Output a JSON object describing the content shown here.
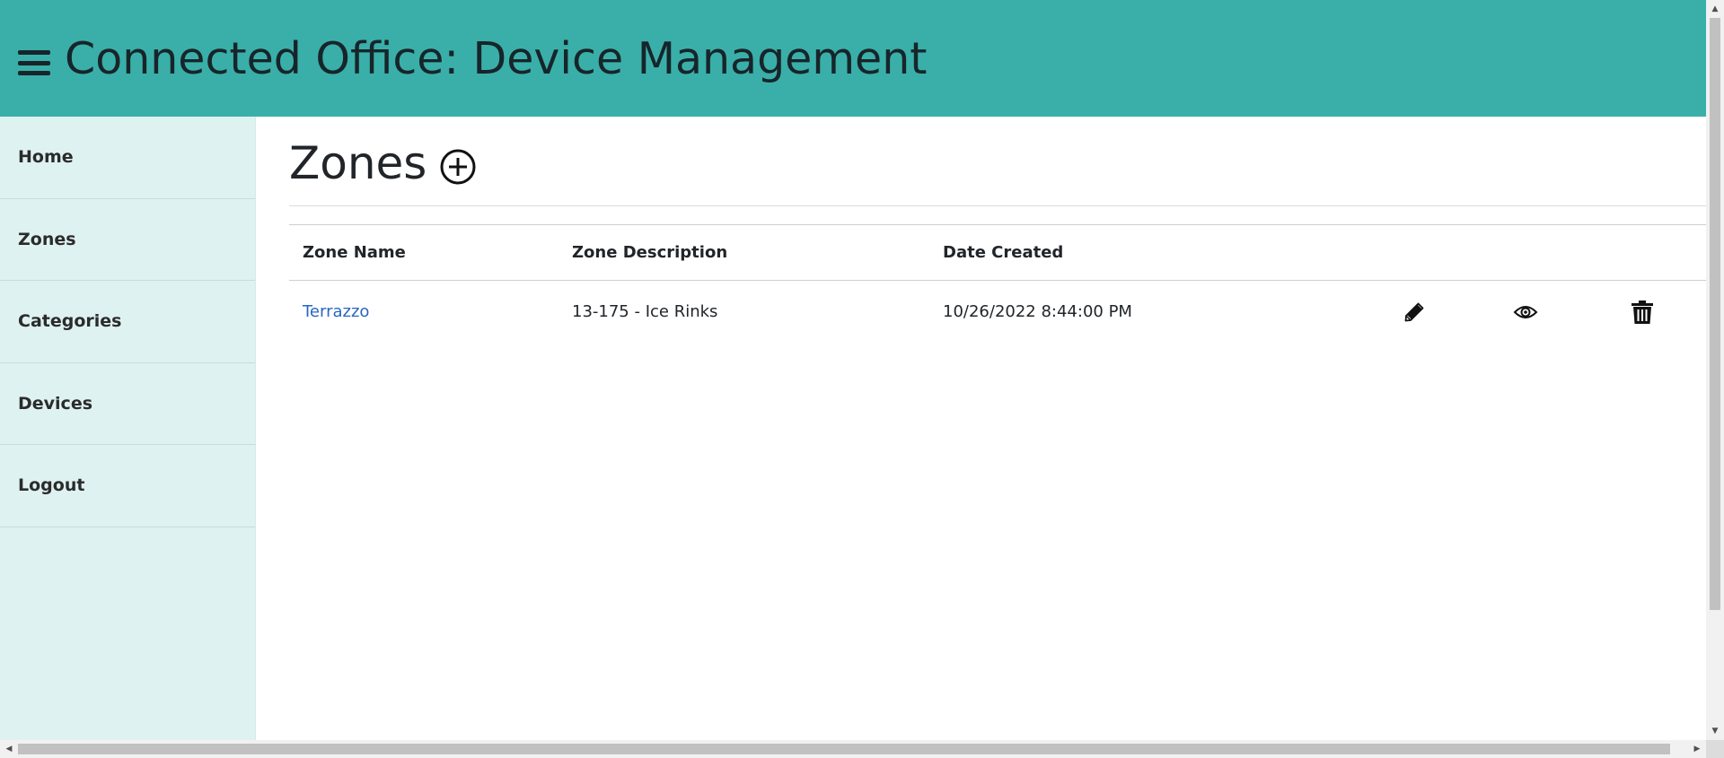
{
  "header": {
    "title": "Connected Office: Device Management",
    "menu_icon": "hamburger-menu-icon",
    "background": "#3aafa9",
    "text_color": "#17252a"
  },
  "sidebar": {
    "background": "#def2f1",
    "items": [
      {
        "label": "Home"
      },
      {
        "label": "Zones"
      },
      {
        "label": "Categories"
      },
      {
        "label": "Devices"
      },
      {
        "label": "Logout"
      }
    ]
  },
  "main": {
    "title": "Zones",
    "add_icon": "plus-circle-icon",
    "table": {
      "columns": [
        "Zone Name",
        "Zone Description",
        "Date Created"
      ],
      "rows": [
        {
          "name": "Terrazzo",
          "description": "13-175 - Ice Rinks",
          "date_created": "10/26/2022 8:44:00 PM",
          "actions": [
            "pencil-icon",
            "eye-icon",
            "trash-icon"
          ]
        }
      ]
    },
    "link_color": "#2a66c3"
  }
}
